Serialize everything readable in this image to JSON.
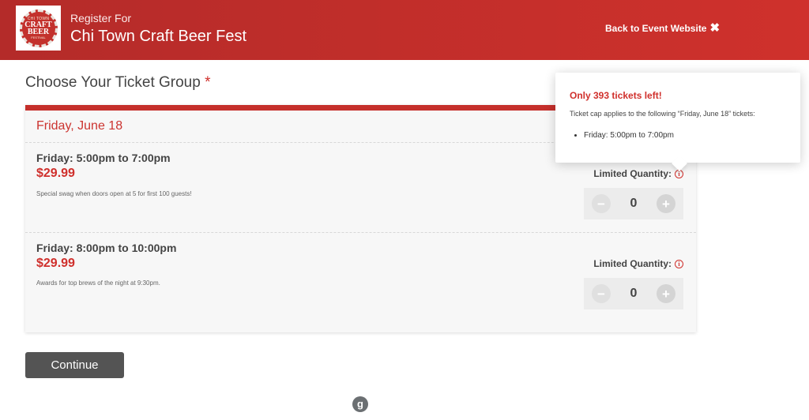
{
  "header": {
    "register_for": "Register For",
    "event_name": "Chi Town Craft Beer Fest",
    "back_link": "Back to Event Website",
    "logo_lines": [
      "CHI TOWN",
      "CRAFT",
      "BEER",
      "FESTIVAL"
    ]
  },
  "main": {
    "title": "Choose Your Ticket Group",
    "required_mark": "*",
    "group": {
      "title": "Friday, June 18",
      "tickets": [
        {
          "name": "Friday: 5:00pm to 7:00pm",
          "price": "$29.99",
          "description": "Special swag when doors open at 5 for first 100 guests!",
          "limited_label": "Limited Quantity:",
          "quantity": "0"
        },
        {
          "name": "Friday: 8:00pm to 10:00pm",
          "price": "$29.99",
          "description": "Awards for top brews of the night at 9:30pm.",
          "limited_label": "Limited Quantity:",
          "quantity": "0"
        }
      ]
    },
    "continue_label": "Continue"
  },
  "popover": {
    "title": "Only 393 tickets left!",
    "text": "Ticket cap applies to the following “Friday, June 18” tickets:",
    "items": [
      "Friday: 5:00pm to 7:00pm"
    ]
  },
  "footer": {
    "logo_letter": "g"
  },
  "colors": {
    "brand_red": "#c52f2b",
    "button_dark": "#545454"
  }
}
